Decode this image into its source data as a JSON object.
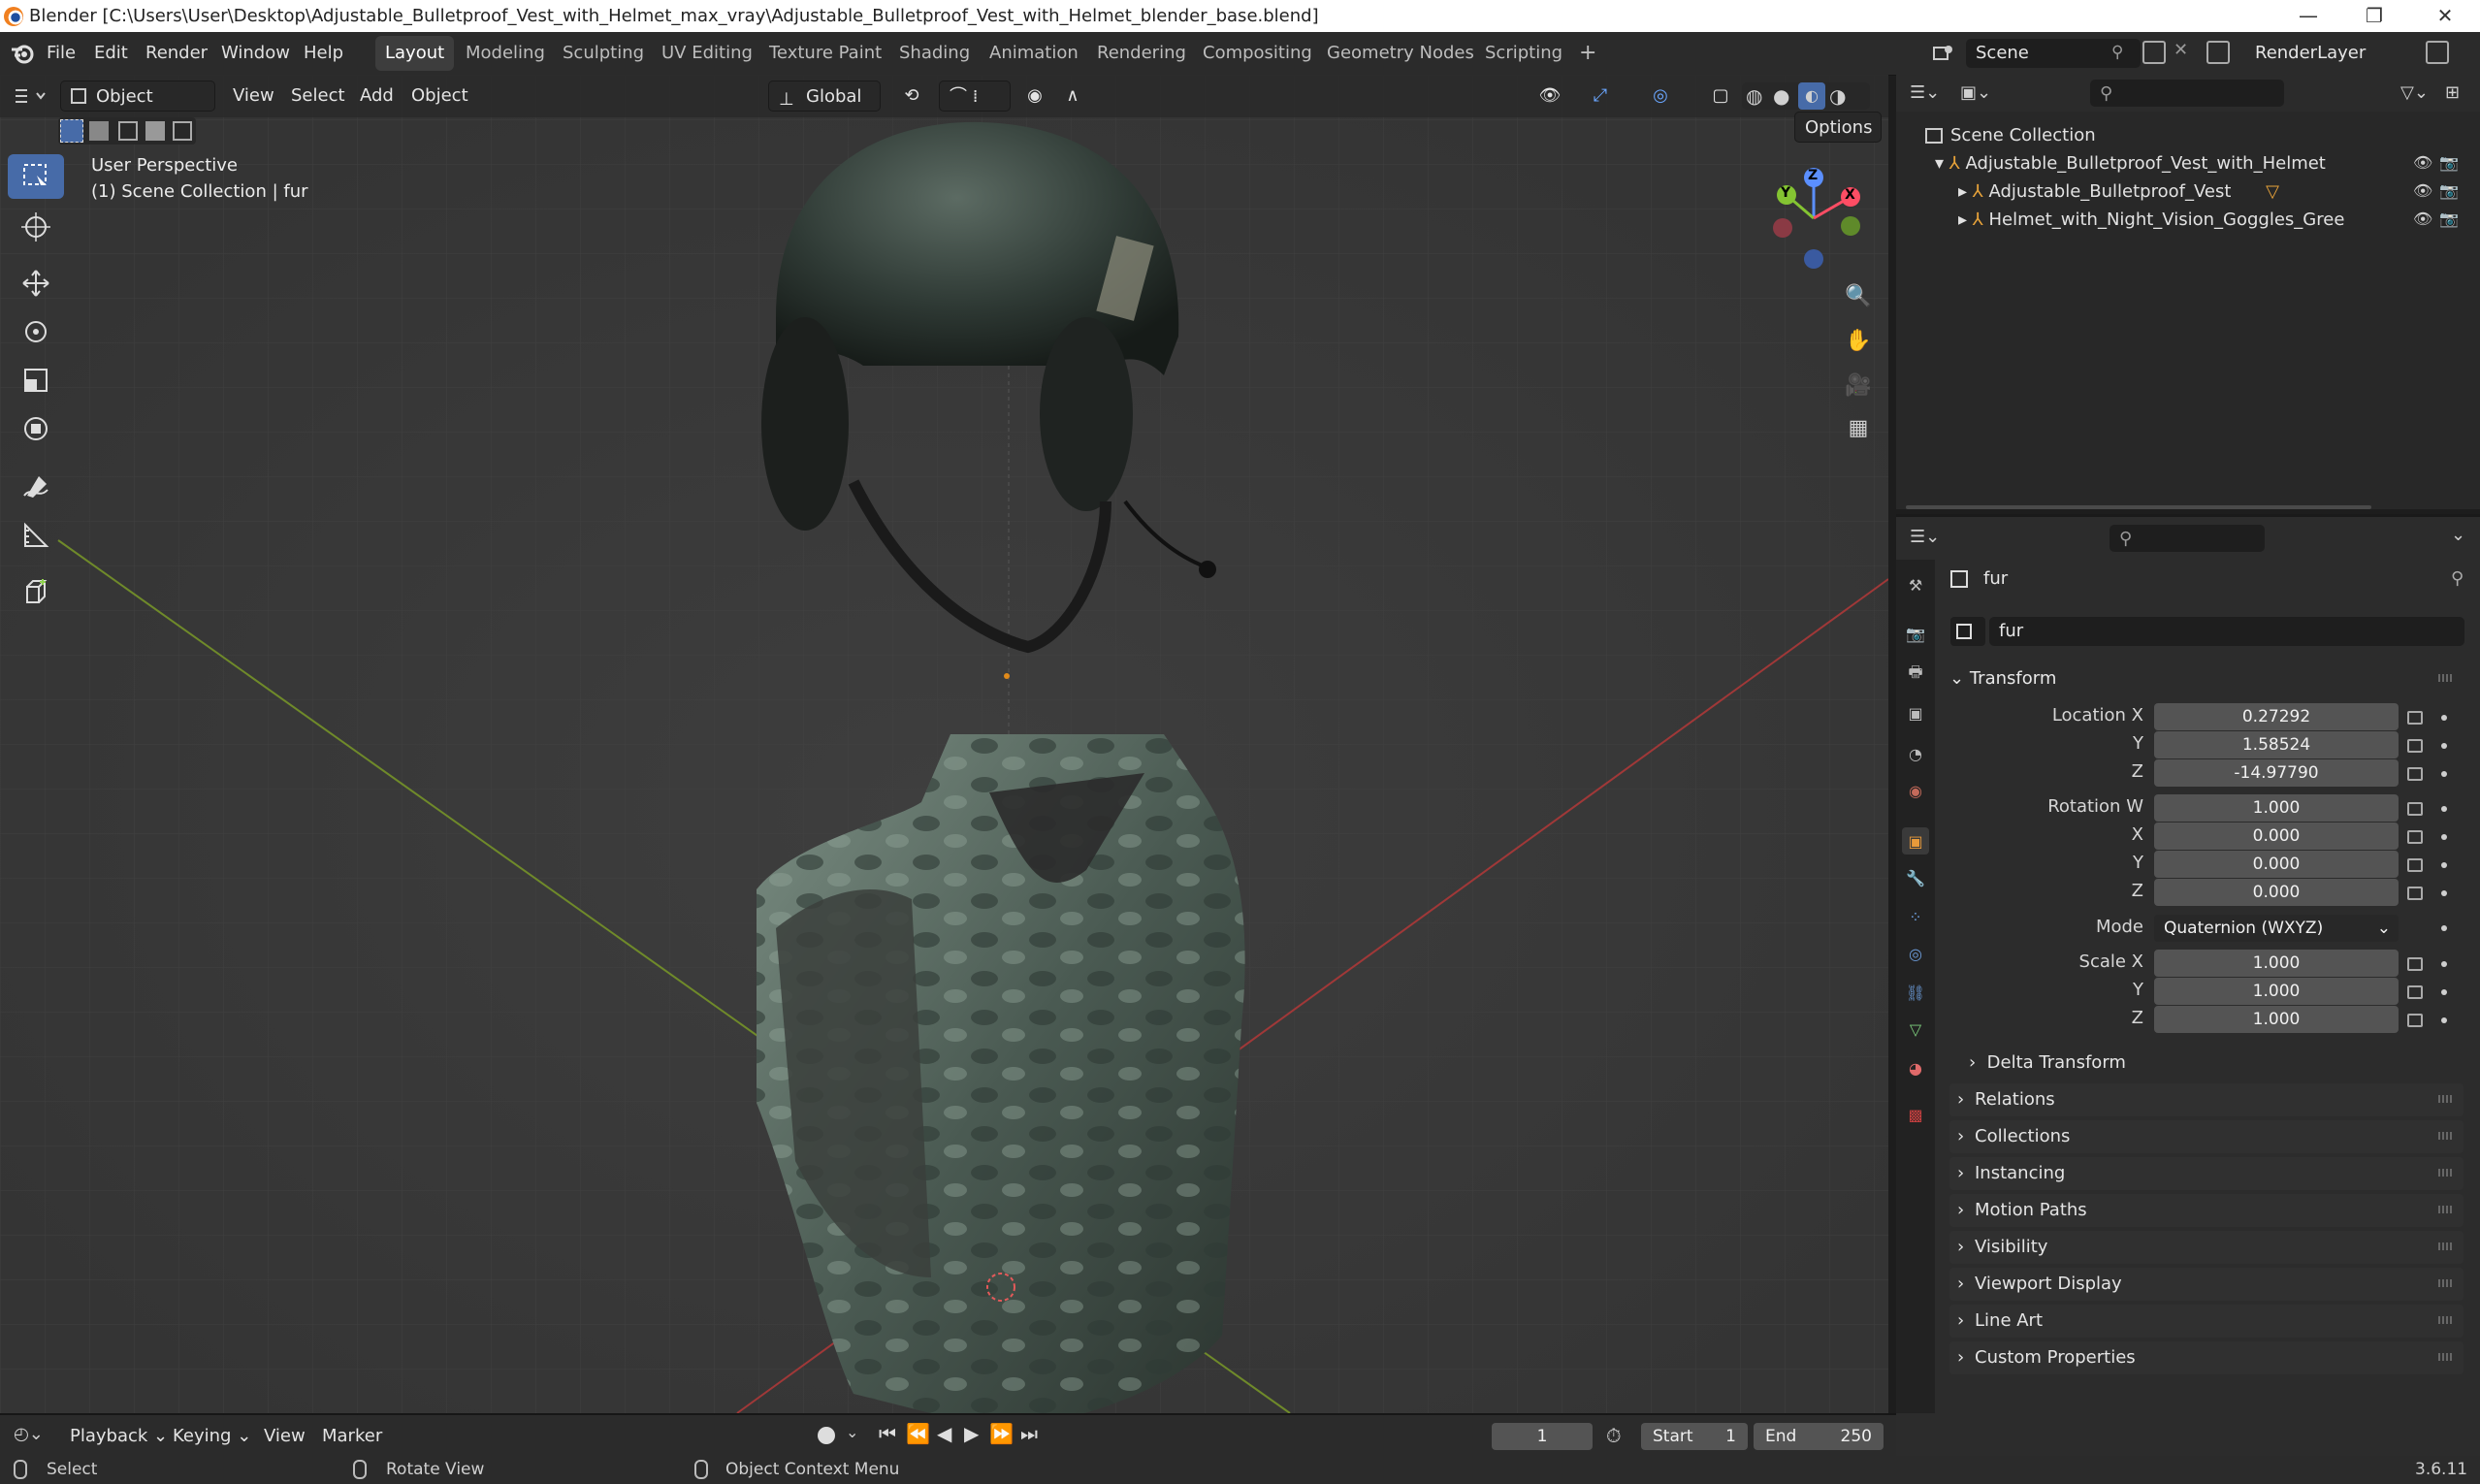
{
  "window": {
    "title": "Blender [C:\\Users\\User\\Desktop\\Adjustable_Bulletproof_Vest_with_Helmet_max_vray\\Adjustable_Bulletproof_Vest_with_Helmet_blender_base.blend]",
    "minimize": "—",
    "maximize": "❐",
    "close": "✕"
  },
  "menu": [
    "File",
    "Edit",
    "Render",
    "Window",
    "Help"
  ],
  "workspaces": [
    "Layout",
    "Modeling",
    "Sculpting",
    "UV Editing",
    "Texture Paint",
    "Shading",
    "Animation",
    "Rendering",
    "Compositing",
    "Geometry Nodes",
    "Scripting"
  ],
  "workspace_add": "+",
  "scene": {
    "name": "Scene",
    "render_layer": "RenderLayer"
  },
  "viewport": {
    "mode": "Object Mode",
    "menus": [
      "View",
      "Select",
      "Add",
      "Object"
    ],
    "transform_orientation": "Global",
    "options": "Options",
    "overlay_line1": "User Perspective",
    "overlay_line2": "(1) Scene Collection | fur",
    "gizmo": {
      "z": "Z",
      "y": "Y",
      "x": "X"
    }
  },
  "outliner": {
    "root": "Scene Collection",
    "items": [
      {
        "label": "Adjustable_Bulletproof_Vest_with_Helmet"
      },
      {
        "label": "Adjustable_Bulletproof_Vest"
      },
      {
        "label": "Helmet_with_Night_Vision_Goggles_Green_Camo"
      }
    ]
  },
  "properties": {
    "object_name": "fur",
    "object_field": "fur",
    "transform_label": "Transform",
    "location": {
      "label": "Location X",
      "x": "0.27292",
      "y": "1.58524",
      "z": "-14.97790"
    },
    "rotation": {
      "label": "Rotation W",
      "w": "1.000",
      "x": "0.000",
      "y": "0.000",
      "z": "0.000"
    },
    "axis": {
      "x": "X",
      "y": "Y",
      "z": "Z"
    },
    "mode_label": "Mode",
    "mode_value": "Quaternion (WXYZ)",
    "scale": {
      "label": "Scale X",
      "x": "1.000",
      "y": "1.000",
      "z": "1.000"
    },
    "delta": "Delta Transform",
    "sections": [
      "Relations",
      "Collections",
      "Instancing",
      "Motion Paths",
      "Visibility",
      "Viewport Display",
      "Line Art",
      "Custom Properties"
    ]
  },
  "timeline": {
    "menus": [
      "Playback",
      "Keying",
      "View",
      "Marker"
    ],
    "current_frame": "1",
    "start_label": "Start",
    "start": "1",
    "end_label": "End",
    "end": "250"
  },
  "status": {
    "select": "Select",
    "rotate": "Rotate View",
    "context": "Object Context Menu",
    "version": "3.6.11"
  }
}
